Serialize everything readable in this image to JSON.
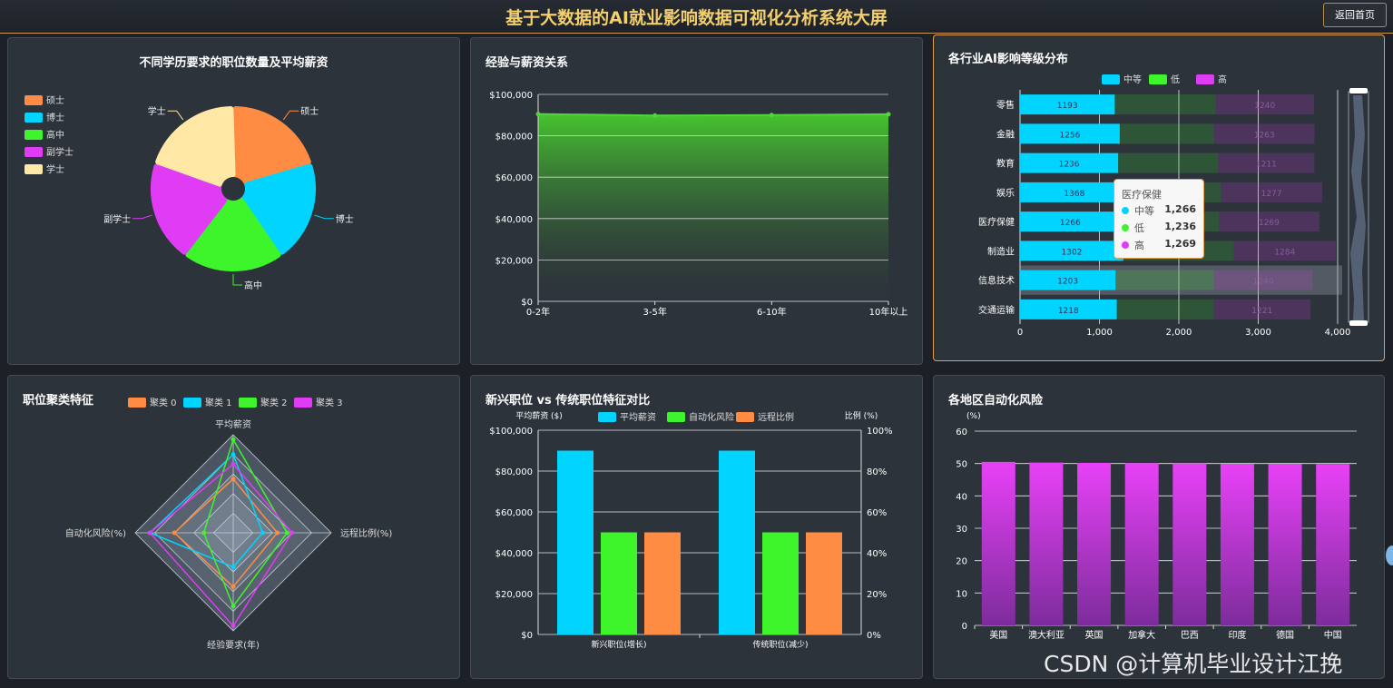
{
  "header": {
    "title": "基于大数据的AI就业影响数据可视化分析系统大屏",
    "back_label": "返回首页"
  },
  "panels": {
    "p1": {
      "title": "不同学历要求的职位数量及平均薪资"
    },
    "p2": {
      "title": "经验与薪资关系"
    },
    "p3": {
      "title": "各行业AI影响等级分布"
    },
    "p4": {
      "title": "职位聚类特征"
    },
    "p5": {
      "title": "新兴职位 vs 传统职位特征对比"
    },
    "p6": {
      "title": "各地区自动化风险"
    }
  },
  "chart_data": [
    {
      "id": "p1",
      "type": "pie",
      "rose": true,
      "legend": [
        "硕士",
        "博士",
        "高中",
        "副学士",
        "学士"
      ],
      "slices": [
        {
          "name": "硕士",
          "value": 20,
          "color": "#ff8c42"
        },
        {
          "name": "博士",
          "value": 20,
          "color": "#00d4ff"
        },
        {
          "name": "高中",
          "value": 20,
          "color": "#3df52a"
        },
        {
          "name": "副学士",
          "value": 20,
          "color": "#e03bf5"
        },
        {
          "name": "学士",
          "value": 20,
          "color": "#ffe8a5"
        }
      ]
    },
    {
      "id": "p2",
      "type": "area",
      "categories": [
        "0-2年",
        "3-5年",
        "6-10年",
        "10年以上"
      ],
      "values": [
        90500,
        89800,
        90000,
        90400
      ],
      "ylim": [
        0,
        100000
      ],
      "yticks": [
        "$0",
        "$20,000",
        "$40,000",
        "$60,000",
        "$80,000",
        "$100,000"
      ],
      "color": "#4fd63a"
    },
    {
      "id": "p3",
      "type": "bar",
      "orientation": "horizontal",
      "stacked": true,
      "categories": [
        "零售",
        "金融",
        "教育",
        "娱乐",
        "医疗保健",
        "制造业",
        "信息技术",
        "交通运输"
      ],
      "series": [
        {
          "name": "中等",
          "color": "#00d4ff",
          "values": [
            1193,
            1256,
            1236,
            1368,
            1266,
            1302,
            1203,
            1218
          ]
        },
        {
          "name": "低",
          "color": "#3df52a",
          "values": [
            1270,
            1190,
            1260,
            1160,
            1236,
            1390,
            1240,
            1220
          ]
        },
        {
          "name": "高",
          "color": "#e03bf5",
          "values": [
            1240,
            1263,
            1211,
            1277,
            1269,
            1284,
            1240,
            1221
          ]
        }
      ],
      "xlim": [
        0,
        4000
      ],
      "xticks": [
        "0",
        "1,000",
        "2,000",
        "3,000",
        "4,000"
      ],
      "tooltip": {
        "title": "医疗保健",
        "rows": [
          {
            "name": "中等",
            "value": "1,266",
            "color": "#00d4ff"
          },
          {
            "name": "低",
            "value": "1,236",
            "color": "#3df52a"
          },
          {
            "name": "高",
            "value": "1,269",
            "color": "#e03bf5"
          }
        ]
      }
    },
    {
      "id": "p4",
      "type": "radar",
      "indicators": [
        "平均薪资",
        "远程比例(%)",
        "经验要求(年)",
        "自动化风险(%)"
      ],
      "series": [
        {
          "name": "聚类 0",
          "color": "#ff8c42",
          "values": [
            0.55,
            0.45,
            0.55,
            0.6
          ]
        },
        {
          "name": "聚类 1",
          "color": "#00d4ff",
          "values": [
            0.8,
            0.3,
            0.35,
            0.85
          ]
        },
        {
          "name": "聚类 2",
          "color": "#3df52a",
          "values": [
            0.95,
            0.55,
            0.75,
            0.3
          ]
        },
        {
          "name": "聚类 3",
          "color": "#e03bf5",
          "values": [
            0.7,
            0.6,
            0.95,
            0.85
          ]
        }
      ]
    },
    {
      "id": "p5",
      "type": "bar",
      "categories": [
        "新兴职位(增长)",
        "传统职位(减少)"
      ],
      "series": [
        {
          "name": "平均薪资",
          "color": "#00d4ff",
          "axis": "left",
          "values": [
            90000,
            90000
          ]
        },
        {
          "name": "自动化风险",
          "color": "#3df52a",
          "axis": "right",
          "values": [
            50,
            50
          ]
        },
        {
          "name": "远程比例",
          "color": "#ff8c42",
          "axis": "right",
          "values": [
            50,
            50
          ]
        }
      ],
      "ylabel_left": "平均薪资 ($)",
      "ylabel_right": "比例 (%)",
      "ylim_left": [
        0,
        100000
      ],
      "ylim_right": [
        0,
        100
      ],
      "yticks_left": [
        "$0",
        "$20,000",
        "$40,000",
        "$60,000",
        "$80,000",
        "$100,000"
      ],
      "yticks_right": [
        "0%",
        "20%",
        "40%",
        "60%",
        "80%",
        "100%"
      ]
    },
    {
      "id": "p6",
      "type": "bar",
      "categories": [
        "美国",
        "澳大利亚",
        "英国",
        "加拿大",
        "巴西",
        "印度",
        "德国",
        "中国"
      ],
      "values": [
        50.5,
        50.3,
        50.2,
        50.1,
        50.0,
        49.9,
        49.9,
        49.8
      ],
      "ylabel": "(%)",
      "ylim": [
        0,
        60
      ],
      "yticks": [
        "0",
        "10",
        "20",
        "30",
        "40",
        "50",
        "60"
      ],
      "color_top": "#e841f7",
      "color_bottom": "#7d2c9c"
    }
  ],
  "watermark": "CSDN @计算机毕业设计江挽"
}
